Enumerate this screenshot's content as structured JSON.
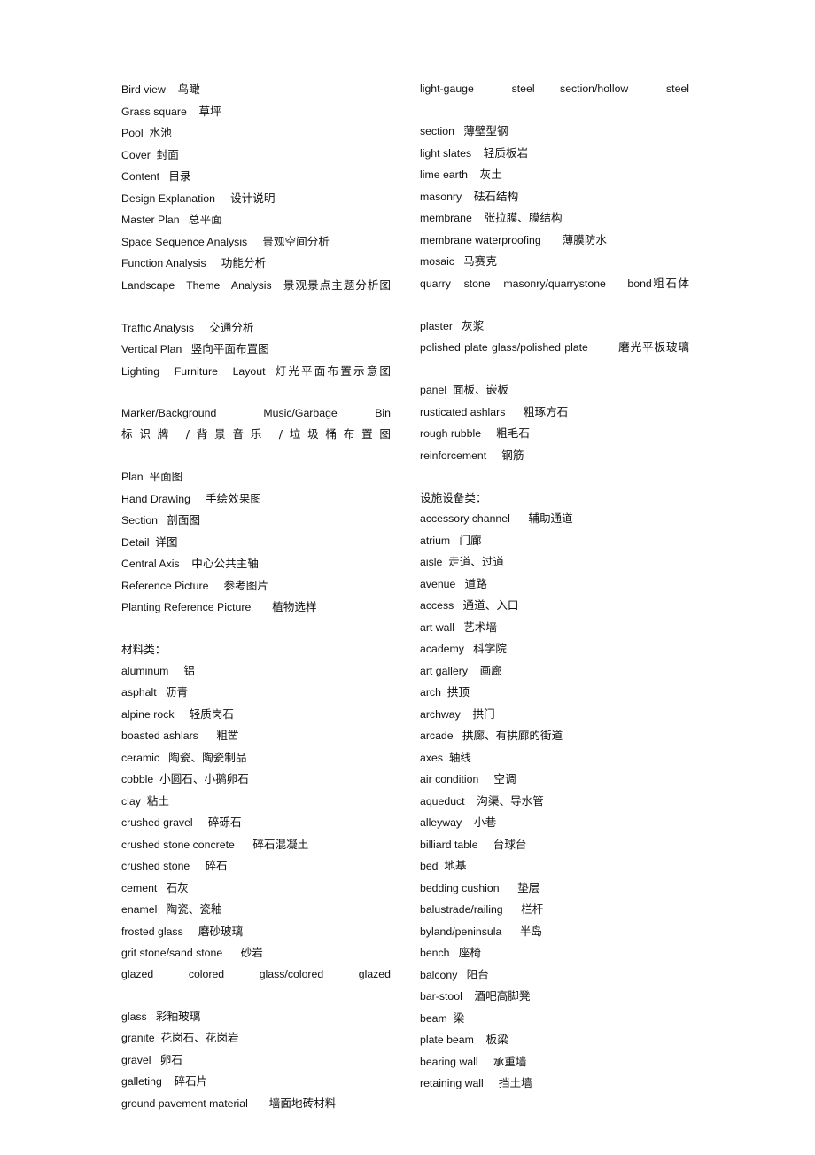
{
  "document": {
    "title": "Architecture and Landscape English-Chinese Glossary",
    "background_color": "#ffffff",
    "text_color": "#111111"
  },
  "left_column": {
    "entries": [
      {
        "term": "Bird view",
        "cn": "鸟瞰",
        "gap": "    ",
        "stretch": false
      },
      {
        "term": "Grass square",
        "cn": "草坪",
        "gap": "    ",
        "stretch": false
      },
      {
        "term": "Pool",
        "cn": "水池",
        "gap": "  ",
        "stretch": false
      },
      {
        "term": "Cover",
        "cn": "封面",
        "gap": "  ",
        "stretch": false
      },
      {
        "term": "Content",
        "cn": "目录",
        "gap": "   ",
        "stretch": false
      },
      {
        "term": "Design Explanation",
        "cn": "设计说明",
        "gap": "     ",
        "stretch": false
      },
      {
        "term": "Master Plan",
        "cn": "总平面",
        "gap": "   ",
        "stretch": false
      },
      {
        "term": "Space Sequence Analysis",
        "cn": "景观空间分析",
        "gap": "     ",
        "stretch": false
      },
      {
        "term": "Function Analysis",
        "cn": "功能分析",
        "gap": "     ",
        "stretch": false
      },
      {
        "term": "Landscape   Theme   Analysis",
        "cn": "景观景点主题分析图",
        "gap": "   ",
        "stretch": true
      },
      {
        "term": "Traffic Analysis",
        "cn": "交通分析",
        "gap": "     ",
        "stretch": false
      },
      {
        "term": "Vertical Plan",
        "cn": "竖向平面布置图",
        "gap": "   ",
        "stretch": false
      },
      {
        "term": "Lighting   Furniture   Layout",
        "cn": "灯光平面布置示意图",
        "gap": "  ",
        "stretch": true
      },
      {
        "term": "Marker/Background     Music/Garbage    Bin",
        "cn": "标识牌 /背景音乐 /垃圾桶布置图",
        "gap": "",
        "stretch": true
      },
      {
        "term": "Plan",
        "cn": "平面图",
        "gap": "  ",
        "stretch": false
      },
      {
        "term": "Hand Drawing",
        "cn": "手绘效果图",
        "gap": "     ",
        "stretch": false
      },
      {
        "term": "Section",
        "cn": "剖面图",
        "gap": "   ",
        "stretch": false
      },
      {
        "term": "Detail",
        "cn": "详图",
        "gap": "  ",
        "stretch": false
      },
      {
        "term": "Central Axis",
        "cn": "中心公共主轴",
        "gap": "    ",
        "stretch": false
      },
      {
        "term": "Reference Picture",
        "cn": "参考图片",
        "gap": "     ",
        "stretch": false
      },
      {
        "term": "Planting Reference Picture",
        "cn": "植物选样",
        "gap": "       ",
        "stretch": false
      }
    ],
    "materials_heading": "材料类：",
    "materials": [
      {
        "term": "aluminum",
        "cn": "铝",
        "gap": "     ",
        "stretch": false
      },
      {
        "term": "asphalt",
        "cn": "沥青",
        "gap": "   ",
        "stretch": false
      },
      {
        "term": "alpine rock",
        "cn": "轻质岗石",
        "gap": "     ",
        "stretch": false
      },
      {
        "term": "boasted ashlars",
        "cn": "粗凿",
        "gap": "      ",
        "stretch": false
      },
      {
        "term": "ceramic",
        "cn": "陶瓷、陶瓷制品",
        "gap": "   ",
        "stretch": false
      },
      {
        "term": "cobble",
        "cn": "小圆石、小鹅卵石",
        "gap": "  ",
        "stretch": false
      },
      {
        "term": "clay",
        "cn": "粘土",
        "gap": "  ",
        "stretch": false
      },
      {
        "term": "crushed gravel",
        "cn": "碎砾石",
        "gap": "     ",
        "stretch": false
      },
      {
        "term": "crushed stone concrete",
        "cn": "碎石混凝土",
        "gap": "      ",
        "stretch": false
      },
      {
        "term": "crushed stone",
        "cn": "碎石",
        "gap": "     ",
        "stretch": false
      },
      {
        "term": "cement",
        "cn": "石灰",
        "gap": "   ",
        "stretch": false
      },
      {
        "term": "enamel",
        "cn": "陶瓷、瓷釉",
        "gap": "   ",
        "stretch": false
      },
      {
        "term": "frosted glass",
        "cn": "磨砂玻璃",
        "gap": "     ",
        "stretch": false
      },
      {
        "term": "grit stone/sand stone",
        "cn": "砂岩",
        "gap": "      ",
        "stretch": false
      },
      {
        "term": "glazed     colored     glass/colored     glazed",
        "cn": "",
        "gap": "",
        "stretch": true
      },
      {
        "term": "glass",
        "cn": "彩釉玻璃",
        "gap": "   ",
        "stretch": false
      },
      {
        "term": "granite",
        "cn": "花岗石、花岗岩",
        "gap": "  ",
        "stretch": false
      },
      {
        "term": "gravel",
        "cn": "卵石",
        "gap": "   ",
        "stretch": false
      },
      {
        "term": "galleting",
        "cn": "碎石片",
        "gap": "    ",
        "stretch": false
      },
      {
        "term": "ground pavement material",
        "cn": "墙面地砖材料",
        "gap": "       ",
        "stretch": false
      }
    ]
  },
  "right_column": {
    "entries": [
      {
        "term": "light-gauge      steel    section/hollow      steel",
        "cn": "",
        "gap": "",
        "stretch": true
      },
      {
        "term": "section",
        "cn": "薄壁型钢",
        "gap": "   ",
        "stretch": false
      },
      {
        "term": "light slates",
        "cn": "轻质板岩",
        "gap": "    ",
        "stretch": false
      },
      {
        "term": "lime earth",
        "cn": "灰土",
        "gap": "    ",
        "stretch": false
      },
      {
        "term": "masonry",
        "cn": "砝石结构",
        "gap": "    ",
        "stretch": false
      },
      {
        "term": "membrane",
        "cn": "张拉膜、膜结构",
        "gap": "    ",
        "stretch": false
      },
      {
        "term": "membrane waterproofing",
        "cn": "薄膜防水",
        "gap": "       ",
        "stretch": false
      },
      {
        "term": "mosaic",
        "cn": "马赛克",
        "gap": "   ",
        "stretch": false
      },
      {
        "term": "quarry   stone   masonry/quarrystone     bond",
        "cn": "粗石体",
        "gap": "",
        "stretch": true
      },
      {
        "term": "plaster",
        "cn": "灰浆",
        "gap": "   ",
        "stretch": false
      },
      {
        "term": "polished plate glass/polished plate",
        "cn": "磨光平板玻璃",
        "gap": "        ",
        "stretch": true
      },
      {
        "term": "panel",
        "cn": "面板、嵌板",
        "gap": "  ",
        "stretch": false
      },
      {
        "term": "rusticated ashlars",
        "cn": "粗琢方石",
        "gap": "      ",
        "stretch": false
      },
      {
        "term": "rough rubble",
        "cn": "粗毛石",
        "gap": "     ",
        "stretch": false
      },
      {
        "term": "reinforcement",
        "cn": "钢筋",
        "gap": "     ",
        "stretch": false
      }
    ],
    "facilities_heading": "设施设备类：",
    "facilities": [
      {
        "term": "accessory channel",
        "cn": "辅助通道",
        "gap": "      ",
        "stretch": false
      },
      {
        "term": "atrium",
        "cn": "门廊",
        "gap": "   ",
        "stretch": false
      },
      {
        "term": "aisle",
        "cn": "走道、过道",
        "gap": "  ",
        "stretch": false
      },
      {
        "term": "avenue",
        "cn": "道路",
        "gap": "   ",
        "stretch": false
      },
      {
        "term": "access",
        "cn": "通道、入口",
        "gap": "   ",
        "stretch": false
      },
      {
        "term": "art wall",
        "cn": "艺术墙",
        "gap": "   ",
        "stretch": false
      },
      {
        "term": "academy",
        "cn": "科学院",
        "gap": "   ",
        "stretch": false
      },
      {
        "term": "art gallery",
        "cn": "画廊",
        "gap": "    ",
        "stretch": false
      },
      {
        "term": "arch",
        "cn": "拱顶",
        "gap": "  ",
        "stretch": false
      },
      {
        "term": "archway",
        "cn": "拱门",
        "gap": "    ",
        "stretch": false
      },
      {
        "term": "arcade",
        "cn": "拱廊、有拱廊的街道",
        "gap": "   ",
        "stretch": false
      },
      {
        "term": "axes",
        "cn": "轴线",
        "gap": "  ",
        "stretch": false
      },
      {
        "term": "air condition",
        "cn": "空调",
        "gap": "     ",
        "stretch": false
      },
      {
        "term": "aqueduct",
        "cn": "沟渠、导水管",
        "gap": "    ",
        "stretch": false
      },
      {
        "term": "alleyway",
        "cn": "小巷",
        "gap": "    ",
        "stretch": false
      },
      {
        "term": "billiard table",
        "cn": "台球台",
        "gap": "     ",
        "stretch": false
      },
      {
        "term": "bed",
        "cn": "地基",
        "gap": "  ",
        "stretch": false
      },
      {
        "term": "bedding cushion",
        "cn": "垫层",
        "gap": "      ",
        "stretch": false
      },
      {
        "term": "balustrade/railing",
        "cn": "栏杆",
        "gap": "      ",
        "stretch": false
      },
      {
        "term": "byland/peninsula",
        "cn": "半岛",
        "gap": "      ",
        "stretch": false
      },
      {
        "term": "bench",
        "cn": "座椅",
        "gap": "   ",
        "stretch": false
      },
      {
        "term": "balcony",
        "cn": "阳台",
        "gap": "   ",
        "stretch": false
      },
      {
        "term": "bar-stool",
        "cn": "酒吧高脚凳",
        "gap": "    ",
        "stretch": false
      },
      {
        "term": "beam",
        "cn": "梁",
        "gap": "  ",
        "stretch": false
      },
      {
        "term": "plate beam",
        "cn": "板梁",
        "gap": "    ",
        "stretch": false
      },
      {
        "term": "bearing wall",
        "cn": "承重墙",
        "gap": "     ",
        "stretch": false
      },
      {
        "term": "retaining wall",
        "cn": "挡土墙",
        "gap": "     ",
        "stretch": false
      }
    ]
  }
}
